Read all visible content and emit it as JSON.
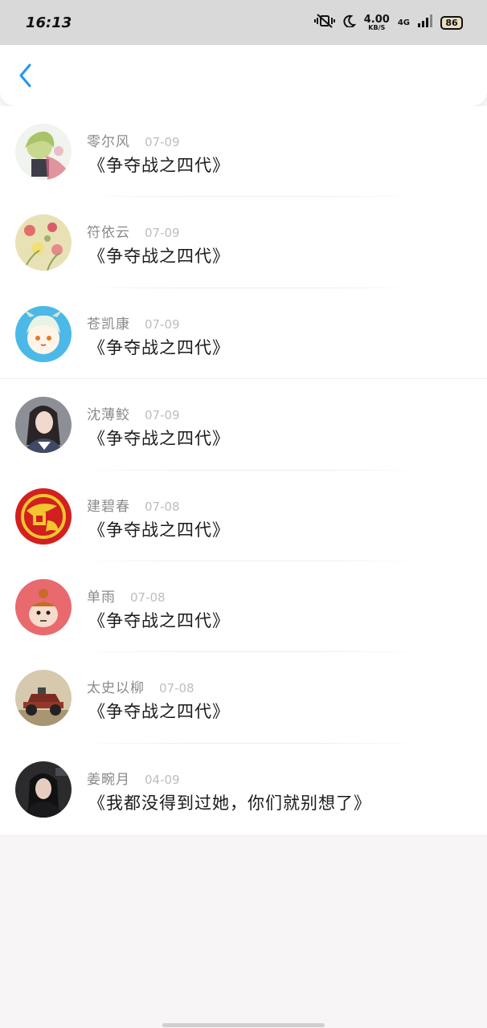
{
  "status_bar": {
    "time": "16:13",
    "speed_value": "4.00",
    "speed_unit": "KB/S",
    "network": "4G",
    "battery": "86"
  },
  "header": {
    "back_icon": "chevron-left-icon",
    "accent_color": "#2196f3"
  },
  "comments": [
    {
      "name": "零尔风",
      "date": "07-09",
      "message": "《争夺战之四代》",
      "avatar": "anime-character-avatar"
    },
    {
      "name": "符依云",
      "date": "07-09",
      "message": "《争夺战之四代》",
      "avatar": "flowers-avatar"
    },
    {
      "name": "苍凯康",
      "date": "07-09",
      "message": "《争夺战之四代》",
      "avatar": "cartoon-girl-avatar"
    },
    {
      "name": "沈薄鲛",
      "date": "07-09",
      "message": "《争夺战之四代》",
      "avatar": "girl-photo-avatar"
    },
    {
      "name": "建碧春",
      "date": "07-08",
      "message": "《争夺战之四代》",
      "avatar": "red-logo-avatar"
    },
    {
      "name": "单雨",
      "date": "07-08",
      "message": "《争夺战之四代》",
      "avatar": "little-my-avatar"
    },
    {
      "name": "太史以柳",
      "date": "07-08",
      "message": "《争夺战之四代》",
      "avatar": "car-avatar"
    },
    {
      "name": "姜畹月",
      "date": "04-09",
      "message": "《我都没得到过她，你们就别想了》",
      "avatar": "dark-photo-avatar"
    }
  ]
}
